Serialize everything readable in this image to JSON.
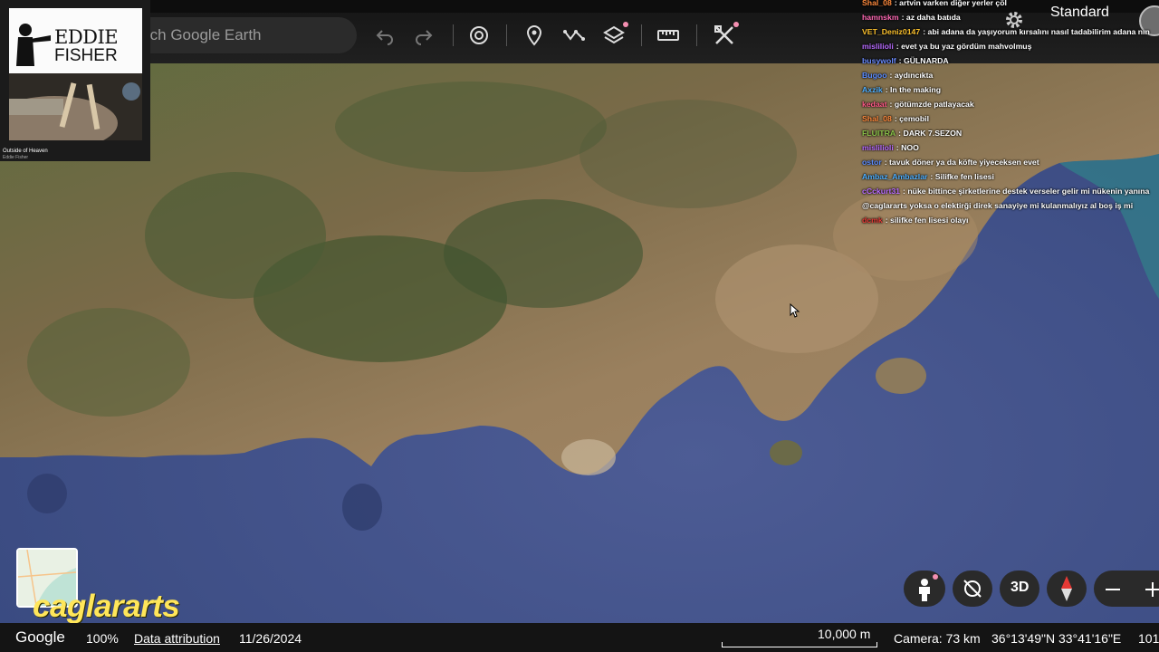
{
  "app": "Google Earth",
  "toolbar": {
    "search_placeholder": "rch Google Earth",
    "icons": [
      "undo-icon",
      "redo-icon",
      "history-icon",
      "place-marker-icon",
      "path-icon",
      "layers-icon",
      "ruler-icon",
      "map-tools-icon"
    ],
    "map_style": "Standard"
  },
  "overlay": {
    "album_title_line1": "EDDIE",
    "album_title_line2": "FISHER",
    "song_title": "Outside of Heaven",
    "song_artist": "Eddie Fisher",
    "streamer_name": "caglararts"
  },
  "chat": [
    {
      "user": "Shal_08",
      "user_color": "#ff8a3d",
      "message": "artvin varken diğer yerler çöl"
    },
    {
      "user": "hamnskm",
      "user_color": "#ff69b4",
      "message": "az daha batıda"
    },
    {
      "user": "VET_Deniz0147",
      "user_color": "#fbc02d",
      "message": "abi adana da yaşıyorum kırsalını nasıl tadabilirim adana nın"
    },
    {
      "user": "mislilioli",
      "user_color": "#b86bff",
      "message": "evet ya bu yaz gördüm mahvolmuş"
    },
    {
      "user": "busywolf",
      "user_color": "#6b8cff",
      "message": "GÜLNARDA"
    },
    {
      "user": "Bugoo",
      "user_color": "#5b8cff",
      "message": "aydıncıkta"
    },
    {
      "user": "Axzik",
      "user_color": "#4fb0ff",
      "message": "In the making"
    },
    {
      "user": "kedaat",
      "user_color": "#ff5a87",
      "message": "götümzde patlayacak"
    },
    {
      "user": "Shal_08",
      "user_color": "#ff8a3d",
      "message": "çemobil"
    },
    {
      "user": "FLUITRA",
      "user_color": "#8bc34a",
      "message": "DARK 7.SEZON"
    },
    {
      "user": "mislilioli",
      "user_color": "#b86bff",
      "message": "NOO"
    },
    {
      "user": "ostor",
      "user_color": "#5b8cff",
      "message": "tavuk döner ya da köfte yiyeceksen evet"
    },
    {
      "user": "Ambaz_Ambazlar",
      "user_color": "#4fb0ff",
      "message": "Silifke fen lisesi"
    },
    {
      "user": "cCckurt31",
      "user_color": "#b86bff",
      "message": "nüke bittince şirketlerine destek verseler gelir mi nükenin yanına"
    },
    {
      "user": "",
      "user_color": "#ffffff",
      "message": "@caglararts yoksa o elektirği direk sanayiye mi kulanmalıyız al boş iş mi"
    },
    {
      "user": "dcmk",
      "user_color": "#e53935",
      "message": "silifke fen lisesi olayı"
    }
  ],
  "controls": {
    "three_d_label": "3D",
    "icons": [
      "pegman-icon",
      "no-tilt-icon",
      "compass-icon",
      "zoom-out-icon",
      "zoom-in-icon"
    ]
  },
  "status_bar": {
    "google": "Google",
    "zoom": "100%",
    "data_attribution": "Data attribution",
    "date": "11/26/2024",
    "scale": "10,000 m",
    "camera": "Camera: 73 km",
    "coordinates": "36°13'49\"N 33°41'16\"E",
    "elevation": "101"
  }
}
